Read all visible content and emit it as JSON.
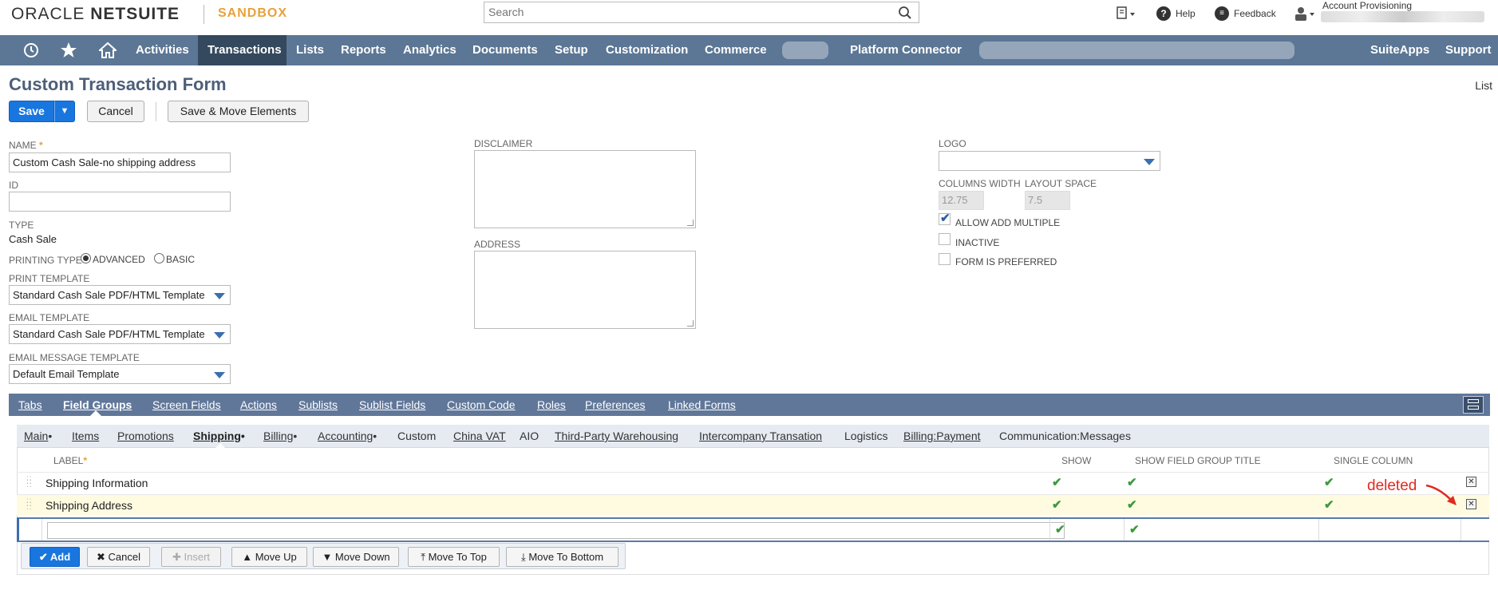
{
  "header": {
    "brand_oracle": "ORACLE",
    "brand_netsuite": "NETSUITE",
    "environment": "SANDBOX",
    "search_placeholder": "Search",
    "help_label": "Help",
    "feedback_label": "Feedback",
    "account_label": "Account Provisioning"
  },
  "nav": {
    "items": [
      "Activities",
      "Transactions",
      "Lists",
      "Reports",
      "Analytics",
      "Documents",
      "Setup",
      "Customization",
      "Commerce",
      "Platform Connector",
      "SuiteApps",
      "Support"
    ],
    "active": "Transactions"
  },
  "page": {
    "title": "Custom Transaction Form",
    "list_link": "List"
  },
  "buttons": {
    "save": "Save",
    "save_arrow": "▼",
    "cancel": "Cancel",
    "save_move": "Save & Move Elements"
  },
  "form": {
    "name_label": "NAME",
    "name_value": "Custom Cash Sale-no shipping address",
    "id_label": "ID",
    "id_value": "",
    "type_label": "TYPE",
    "type_value": "Cash Sale",
    "printing_type_label": "PRINTING TYPE",
    "printing_advanced": "ADVANCED",
    "printing_basic": "BASIC",
    "print_template_label": "PRINT TEMPLATE",
    "print_template_value": "Standard Cash Sale PDF/HTML Template",
    "email_template_label": "EMAIL TEMPLATE",
    "email_template_value": "Standard Cash Sale PDF/HTML Template",
    "email_message_label": "EMAIL MESSAGE TEMPLATE",
    "email_message_value": "Default Email Template",
    "disclaimer_label": "DISCLAIMER",
    "address_label": "ADDRESS",
    "logo_label": "LOGO",
    "logo_value": "",
    "columns_width_label": "COLUMNS WIDTH",
    "columns_width_value": "12.75",
    "layout_space_label": "LAYOUT SPACE",
    "layout_space_value": "7.5",
    "allow_add_multiple": "ALLOW ADD MULTIPLE",
    "allow_add_multiple_checked": true,
    "inactive": "INACTIVE",
    "form_preferred": "FORM IS PREFERRED"
  },
  "subtabs": {
    "items": [
      "Tabs",
      "Field Groups",
      "Screen Fields",
      "Actions",
      "Sublists",
      "Sublist Fields",
      "Custom Code",
      "Roles",
      "Preferences",
      "Linked Forms"
    ],
    "active": "Field Groups"
  },
  "inner_tabs": {
    "items": [
      "Main",
      "Items",
      "Promotions",
      "Shipping",
      "Billing",
      "Accounting",
      "Custom",
      "China VAT",
      "AIO",
      "Third-Party Warehousing",
      "Intercompany Transation",
      "Logistics",
      "Billing:Payment",
      "Communication:Messages"
    ],
    "active": "Shipping",
    "dot_marker": "•"
  },
  "grid": {
    "headers": {
      "label": "LABEL",
      "show": "SHOW",
      "show_title": "SHOW FIELD GROUP TITLE",
      "single_column": "SINGLE COLUMN"
    },
    "rows": [
      {
        "label": "Shipping Information",
        "show": true,
        "show_title": true,
        "single_column": true
      },
      {
        "label": "Shipping Address",
        "show": true,
        "show_title": true,
        "single_column": true
      }
    ],
    "check_glyph": "✔",
    "remove_glyph": "✕"
  },
  "grid_actions": {
    "add": "Add",
    "cancel": "Cancel",
    "insert": "Insert",
    "move_up": "Move Up",
    "move_down": "Move Down",
    "move_top": "Move To Top",
    "move_bottom": "Move To Bottom"
  },
  "annotation": {
    "text": "deleted",
    "color": "#e12a20"
  },
  "colors": {
    "nav_bg": "#5c7795",
    "nav_active": "#34495e",
    "primary": "#1876de",
    "title": "#4d5f79",
    "sandbox": "#e8a13a",
    "check": "#3c9a3c"
  }
}
